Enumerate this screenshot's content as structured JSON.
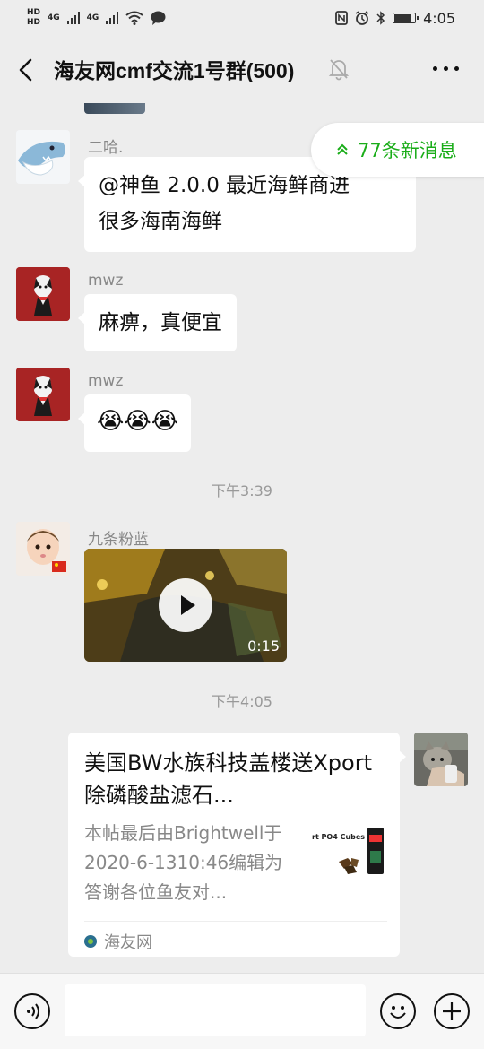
{
  "status_bar": {
    "hd_1": "HD",
    "hd_2": "HD",
    "net_1": "4G",
    "net_2": "4G",
    "time": "4:05",
    "battery_level": 0.85
  },
  "header": {
    "back_icon": "chevron-left-icon",
    "title": "海友网cmf交流1号群(500)",
    "mute_icon": "bell-off-icon",
    "more_icon": "more-dots-icon"
  },
  "new_messages": {
    "label": "77条新消息",
    "icon": "double-chevron-up-icon",
    "color": "#1aad19"
  },
  "messages": [
    {
      "sender": "二哈.",
      "text_line1": "@神鱼 2.0.0  最近海鲜商进",
      "text_line2": "很多海南海鲜"
    },
    {
      "sender": "mwz",
      "text": "麻痹，真便宜"
    },
    {
      "sender": "mwz",
      "text": "😭😭😭"
    }
  ],
  "timestamps": [
    "下午3:39",
    "下午4:05"
  ],
  "video_message": {
    "sender": "九条粉蓝",
    "duration": "0:15"
  },
  "link_card": {
    "title": "美国BW水族科技盖楼送Xport除磷酸盐滤石...",
    "desc": "本帖最后由Brightwell于2020-6-1310:46编辑为答谢各位鱼友对...",
    "thumb_label": "rt PO4 Cubes",
    "source": "海友网"
  },
  "input_bar": {
    "voice_icon": "voice-icon",
    "emoji_icon": "emoji-icon",
    "plus_icon": "plus-icon",
    "placeholder": ""
  }
}
